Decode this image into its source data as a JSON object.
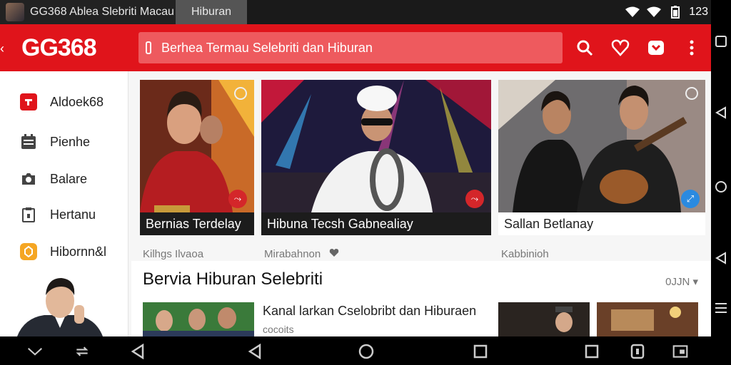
{
  "status_bar": {
    "app_title": "GG368  Ablea Slebriti Macau",
    "tab_label": "Hiburan",
    "time": "123"
  },
  "app_bar": {
    "logo": "GG368",
    "search_text": "Berhea Termau Selebriti dan Hiburan"
  },
  "sidebar": {
    "items": [
      {
        "label": "Aldoek68",
        "icon": "brand-icon",
        "color": "#e0141b"
      },
      {
        "label": "Pienhe",
        "icon": "calendar-icon",
        "color": "#444444"
      },
      {
        "label": "Balare",
        "icon": "camera-icon",
        "color": "#444444"
      },
      {
        "label": "Hertanu",
        "icon": "clipboard-icon",
        "color": "#444444"
      },
      {
        "label": "Hibornn&l",
        "icon": "coin-icon",
        "color": "#f5a623"
      }
    ]
  },
  "cards": [
    {
      "caption": "Bernias Terdelay",
      "meta": "Kilhgs Ilvaoa"
    },
    {
      "caption": "Hibuna Tecsh Gabnealiay",
      "meta": "Mirabahnon"
    },
    {
      "caption": "Sallan Betlanay",
      "meta": "Kabbinioh"
    }
  ],
  "section": {
    "title": "Bervia Hiburan Selebriti",
    "sort_label": "0JJN",
    "item_title": "Kanal larkan Cselobribt dan Hiburaen",
    "item_sub": "cocoits"
  },
  "colors": {
    "brand_red": "#e0141b",
    "search_bg": "#ee5a5e",
    "caption_dark": "#1c1c1c"
  }
}
